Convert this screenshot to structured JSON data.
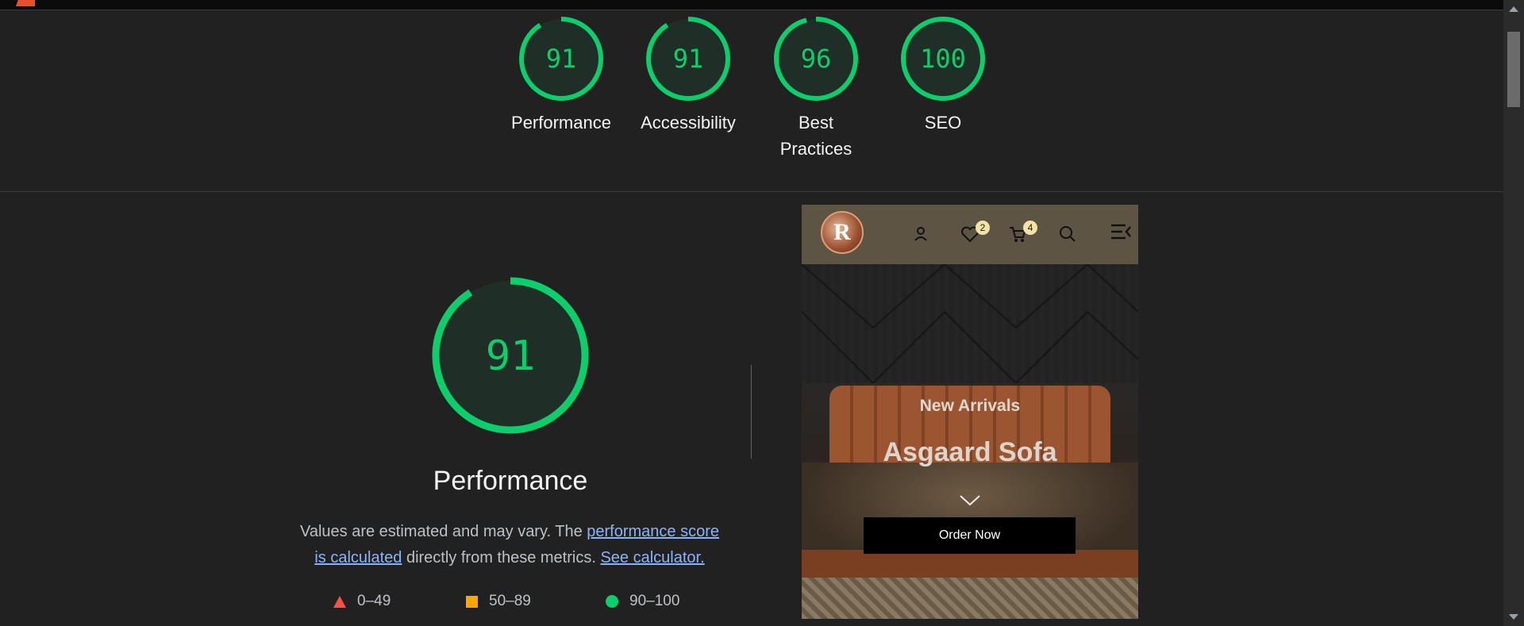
{
  "colors": {
    "pass": "#0cce6b",
    "average": "#ffa400",
    "fail": "#ff4e42",
    "link": "#8ab4f8",
    "background": "#212121"
  },
  "scores": [
    {
      "value": "91",
      "label": "Performance",
      "score": 0.91
    },
    {
      "value": "91",
      "label": "Accessibility",
      "score": 0.91
    },
    {
      "value": "96",
      "label": "Best Practices",
      "score": 0.96
    },
    {
      "value": "100",
      "label": "SEO",
      "score": 1.0
    }
  ],
  "performance": {
    "score": "91",
    "score_fraction": 0.91,
    "title": "Performance",
    "desc_text_1": "Values are estimated and may vary. The ",
    "desc_link_1": "performance score is calculated",
    "desc_text_2": " directly from these metrics. ",
    "desc_link_2": "See calculator."
  },
  "legend": [
    {
      "range": "0–49",
      "icon": "fail-triangle-icon"
    },
    {
      "range": "50–89",
      "icon": "average-square-icon"
    },
    {
      "range": "90–100",
      "icon": "pass-circle-icon"
    }
  ],
  "screenshot": {
    "logo_letter": "R",
    "wishlist_count": "2",
    "cart_count": "4",
    "hero_subtitle": "New Arrivals",
    "hero_title": "Asgaard Sofa",
    "cta_label": "Order Now"
  }
}
